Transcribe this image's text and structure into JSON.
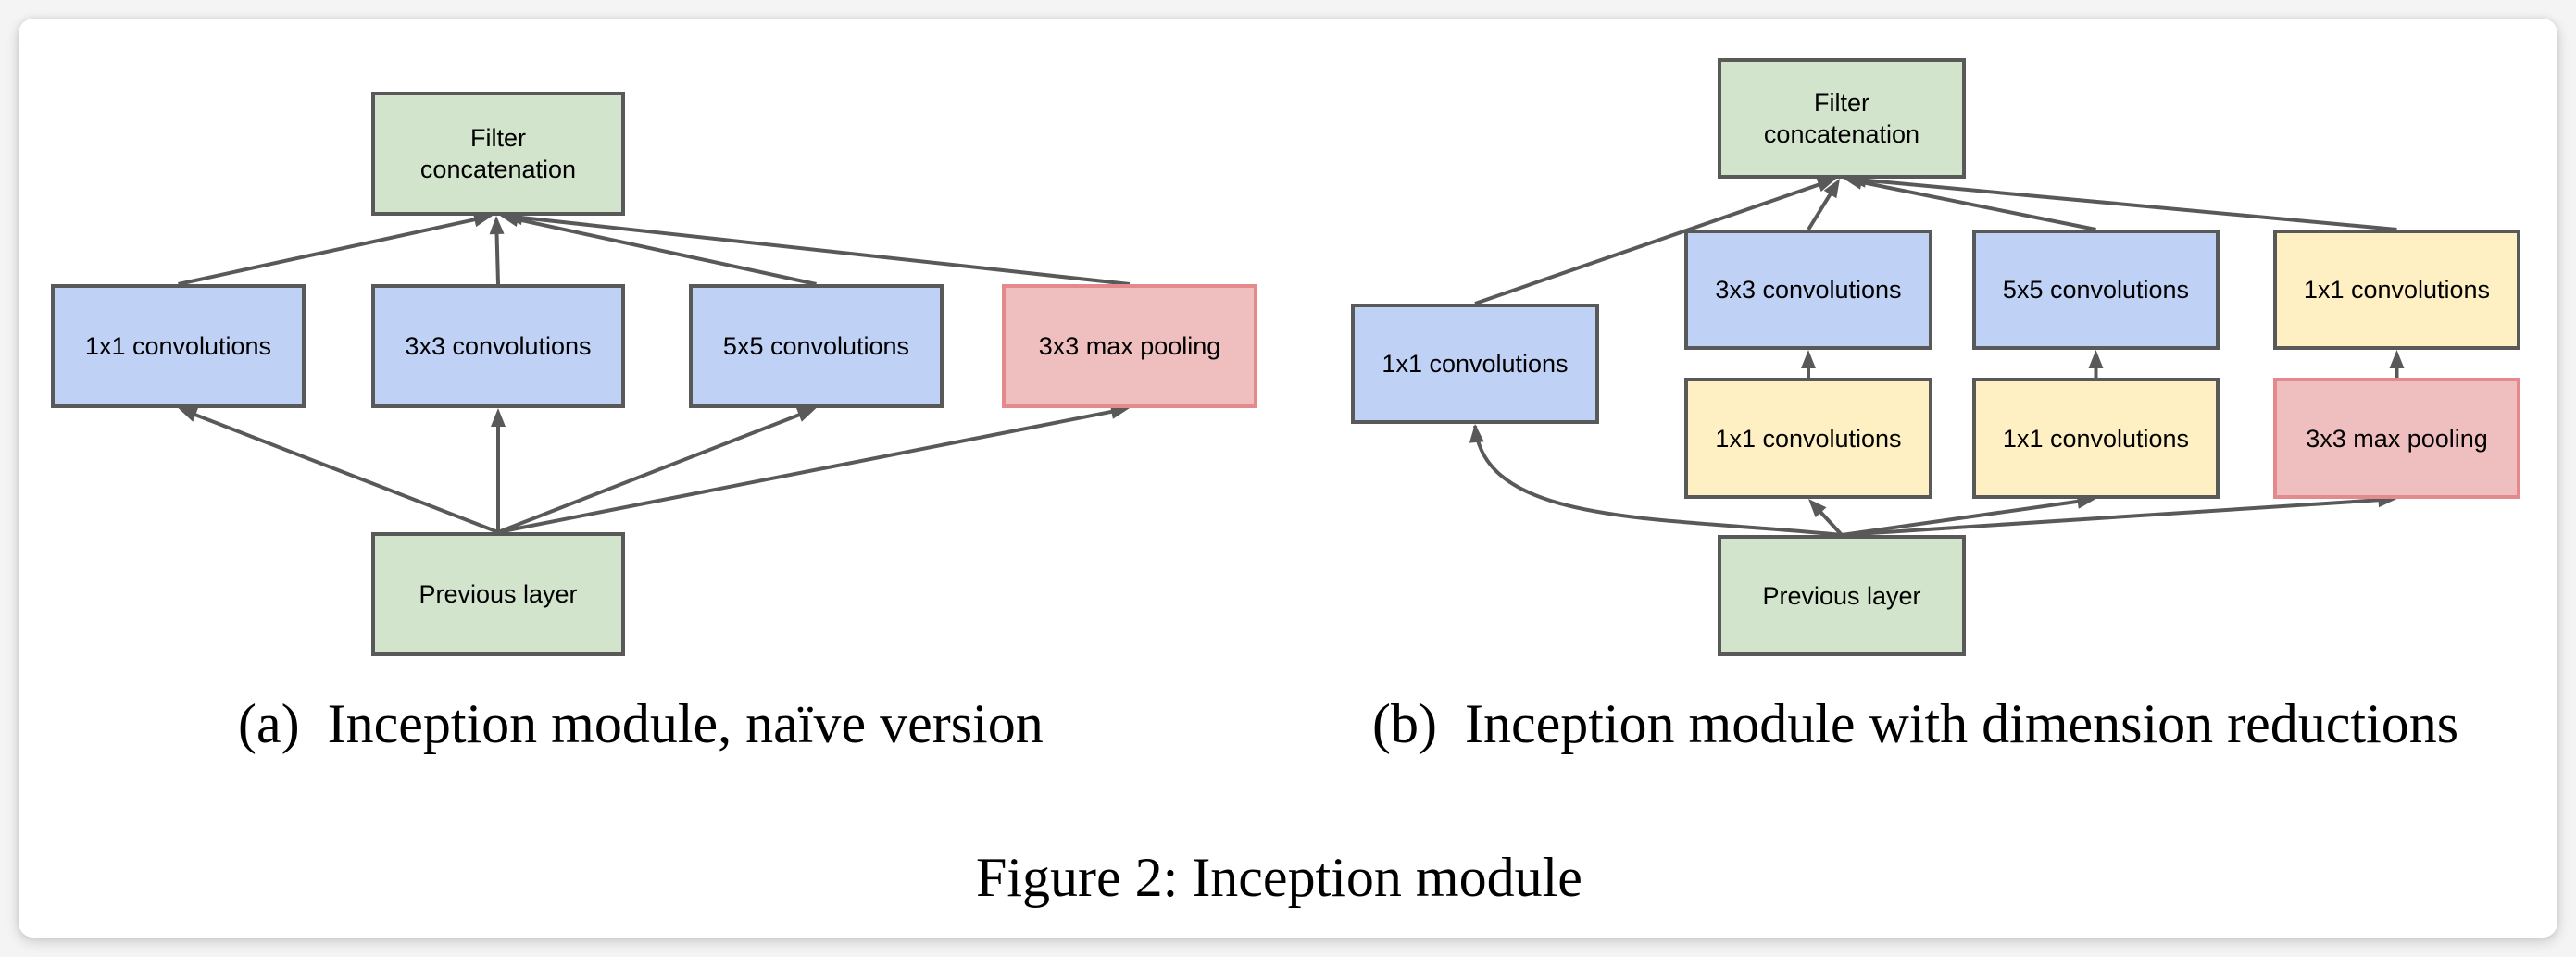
{
  "figure": {
    "caption": "Figure 2: Inception module",
    "subfigures": [
      {
        "id": "a",
        "caption": "(a) Inception module, naïve version",
        "nodes": [
          {
            "id": "a_filter",
            "label": "Filter\nconcatenation",
            "color": "green"
          },
          {
            "id": "a_c1",
            "label": "1x1 convolutions",
            "color": "blue"
          },
          {
            "id": "a_c3",
            "label": "3x3 convolutions",
            "color": "blue"
          },
          {
            "id": "a_c5",
            "label": "5x5 convolutions",
            "color": "blue"
          },
          {
            "id": "a_pool",
            "label": "3x3 max pooling",
            "color": "red"
          },
          {
            "id": "a_prev",
            "label": "Previous layer",
            "color": "green"
          }
        ],
        "edges": [
          {
            "from": "a_prev",
            "to": "a_c1"
          },
          {
            "from": "a_prev",
            "to": "a_c3"
          },
          {
            "from": "a_prev",
            "to": "a_c5"
          },
          {
            "from": "a_prev",
            "to": "a_pool"
          },
          {
            "from": "a_c1",
            "to": "a_filter"
          },
          {
            "from": "a_c3",
            "to": "a_filter"
          },
          {
            "from": "a_c5",
            "to": "a_filter"
          },
          {
            "from": "a_pool",
            "to": "a_filter"
          }
        ]
      },
      {
        "id": "b",
        "caption": "(b) Inception module with dimension reductions",
        "nodes": [
          {
            "id": "b_filter",
            "label": "Filter\nconcatenation",
            "color": "green"
          },
          {
            "id": "b_c1",
            "label": "1x1 convolutions",
            "color": "blue"
          },
          {
            "id": "b_c3",
            "label": "3x3 convolutions",
            "color": "blue"
          },
          {
            "id": "b_c5",
            "label": "5x5 convolutions",
            "color": "blue"
          },
          {
            "id": "b_pp",
            "label": "1x1 convolutions",
            "color": "yellow"
          },
          {
            "id": "b_r3",
            "label": "1x1 convolutions",
            "color": "yellow"
          },
          {
            "id": "b_r5",
            "label": "1x1 convolutions",
            "color": "yellow"
          },
          {
            "id": "b_pool",
            "label": "3x3 max pooling",
            "color": "red"
          },
          {
            "id": "b_prev",
            "label": "Previous layer",
            "color": "green"
          }
        ],
        "edges": [
          {
            "from": "b_prev",
            "to": "b_c1",
            "curved": true
          },
          {
            "from": "b_prev",
            "to": "b_r3"
          },
          {
            "from": "b_prev",
            "to": "b_r5"
          },
          {
            "from": "b_prev",
            "to": "b_pool"
          },
          {
            "from": "b_r3",
            "to": "b_c3"
          },
          {
            "from": "b_r5",
            "to": "b_c5"
          },
          {
            "from": "b_pool",
            "to": "b_pp"
          },
          {
            "from": "b_c1",
            "to": "b_filter"
          },
          {
            "from": "b_c3",
            "to": "b_filter"
          },
          {
            "from": "b_c5",
            "to": "b_filter"
          },
          {
            "from": "b_pp",
            "to": "b_filter"
          }
        ]
      }
    ]
  },
  "colors": {
    "green": "#d2e4cb",
    "blue": "#bfd1f5",
    "yellow": "#fff0c4",
    "red": "#efbebf",
    "red_border": "#e48a8c",
    "border": "#595959",
    "edge": "#595959"
  }
}
